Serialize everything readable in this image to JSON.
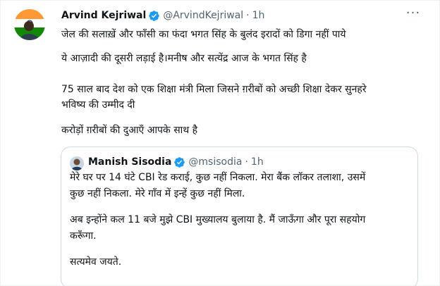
{
  "tweet": {
    "author_name": "Arvind Kejriwal",
    "author_handle": "@ArvindKejriwal",
    "separator": "·",
    "time": "1h",
    "more_label": "···",
    "body": [
      "जेल की सलाख़ें और फाँसी का फंदा भगत सिंह के बुलंद इरादों को डिगा नहीं पाये",
      "ये आज़ादी की दूसरी लड़ाई है।मनीष और सत्येंद्र आज के भगत सिंह है",
      "75 साल बाद देश को एक शिक्षा मंत्री मिला जिसने ग़रीबों को अच्छी शिक्षा देकर सुनहरे",
      "भविष्य की उम्मीद दी",
      "करोड़ों ग़रीबों की दुआएँ आपके साथ है"
    ]
  },
  "quoted_tweet": {
    "author_name": "Manish Sisodia",
    "author_handle": "@msisodia",
    "separator": "·",
    "time": "1h",
    "body": [
      "मेरे घर पर 14 घंटे CBI रेड कराई, कुछ नहीं निकला. मेरा बैंक लॉकर तलाशा, उसमें",
      "कुछ नहीं निकला. मेरे गाँव में इन्हें कुछ नहीं मिला.",
      "अब इन्होंने कल 11 बजे मुझे CBI मुख्यालय बुलाया है. मैं जाऊँगा और पूरा सहयोग",
      "करूँगा.",
      "सत्यमेव जयते."
    ]
  },
  "colors": {
    "verified": "#1d9bf0",
    "secondary_text": "#536471",
    "border": "#cfd9de",
    "saffron": "#ff9933",
    "india_green": "#138808"
  },
  "icons": {
    "verified": "verified-badge-icon",
    "more": "more-options-icon"
  }
}
